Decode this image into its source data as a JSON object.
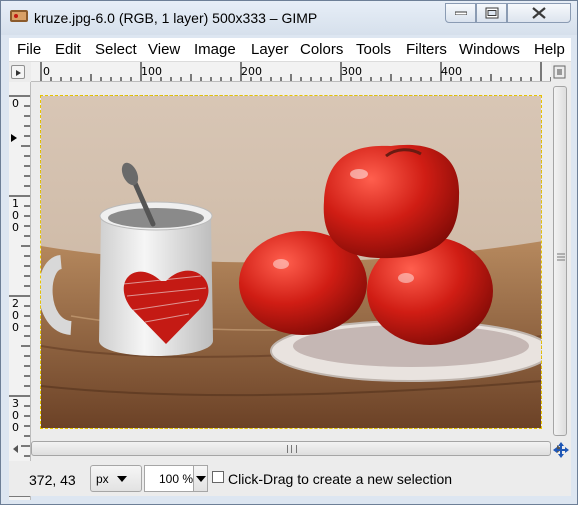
{
  "window": {
    "title": "kruze.jpg-6.0 (RGB, 1 layer) 500x333 – GIMP",
    "app_icon": "gimp-icon",
    "controls": [
      "minimize-icon",
      "maximize-icon",
      "close-icon"
    ]
  },
  "menubar": {
    "items": [
      {
        "label": "File"
      },
      {
        "label": "Edit"
      },
      {
        "label": "Select"
      },
      {
        "label": "View"
      },
      {
        "label": "Image"
      },
      {
        "label": "Layer"
      },
      {
        "label": "Colors"
      },
      {
        "label": "Tools"
      },
      {
        "label": "Filters"
      },
      {
        "label": "Windows"
      },
      {
        "label": "Help"
      }
    ]
  },
  "rulers": {
    "horizontal": [
      "0",
      "100",
      "200",
      "300",
      "400"
    ],
    "vertical": [
      [
        "0"
      ],
      [
        "1",
        "0",
        "0"
      ],
      [
        "2",
        "0",
        "0"
      ],
      [
        "3",
        "0",
        "0"
      ]
    ]
  },
  "canvas": {
    "image_description_icon": "photo",
    "selection_style": "marching-ants"
  },
  "statusbar": {
    "coords": "372, 43",
    "unit": "px",
    "zoom": "100 %",
    "message": "Click-Drag to create a new selection"
  },
  "colors": {
    "titlebar": "#dde6f1",
    "workspace": "#ececec",
    "tomato": "#c41a14",
    "table_wood": "#b58a5e"
  }
}
